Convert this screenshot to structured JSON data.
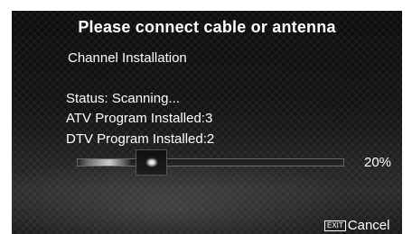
{
  "dialog": {
    "title": "Please connect cable or antenna",
    "subtitle": "Channel Installation",
    "status_line": "Status: Scanning...",
    "atv_line": "ATV Program Installed:3",
    "dtv_line": "DTV Program Installed:2",
    "progress": {
      "percent_text": "20%",
      "value": 0.2
    },
    "cancel": {
      "key_label": "EXIT",
      "label": "Cancel"
    }
  }
}
